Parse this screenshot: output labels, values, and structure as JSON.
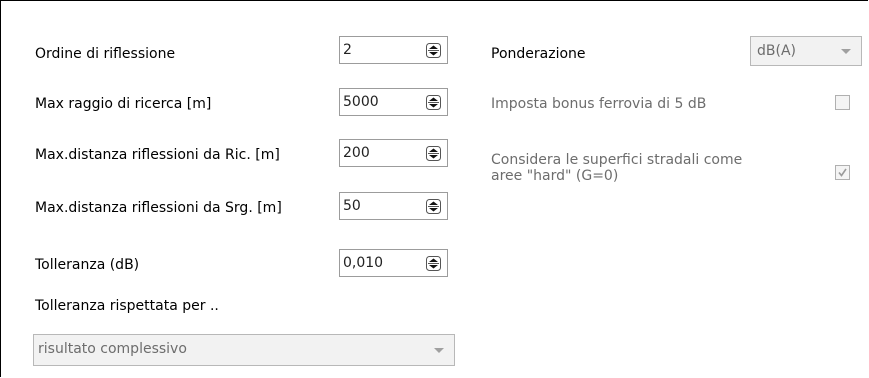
{
  "left": {
    "rows": [
      {
        "label": "Ordine di riflessione",
        "value": "2"
      },
      {
        "label": "Max raggio di ricerca [m]",
        "value": "5000"
      },
      {
        "label": "Max.distanza riflessioni da Ric. [m]",
        "value": "200"
      },
      {
        "label": "Max.distanza riflessioni da Srg. [m]",
        "value": "50"
      },
      {
        "label": "Tolleranza (dB)",
        "value": "0,010"
      }
    ],
    "tolerance_label": "Tolleranza rispettata per ..",
    "tolerance_select": "risultato complessivo"
  },
  "right": {
    "weighting_label": "Ponderazione",
    "weighting_value": "dB(A)",
    "railway_bonus_label": "Imposta bonus ferrovia di 5 dB",
    "railway_bonus_checked": false,
    "hard_surfaces_label_line1": "Considera le superfici stradali come",
    "hard_surfaces_label_line2": "aree \"hard\" (G=0)",
    "hard_surfaces_checked": true
  },
  "icons": {
    "spinner": "up-down-arrows-icon",
    "dropdown": "chevron-down-icon",
    "checkbox_checked": "check-icon"
  }
}
